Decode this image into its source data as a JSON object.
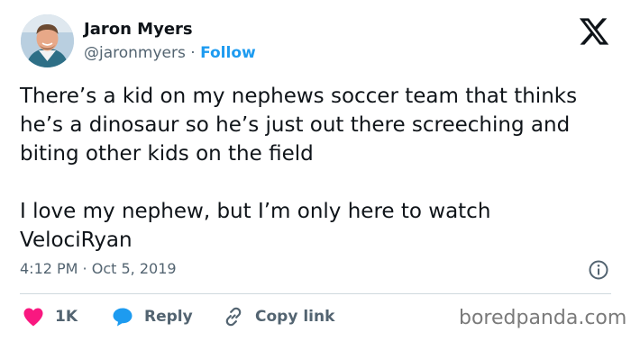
{
  "author": {
    "name": "Jaron Myers",
    "handle": "@jaronmyers",
    "separator": "·",
    "follow_label": "Follow"
  },
  "tweet": {
    "paragraphs": [
      "There’s a kid on my nephews soccer team that thinks he’s a dinosaur so he’s just out there screeching and biting other kids on the field",
      "I love my nephew, but I’m only here to watch VelociRyan"
    ],
    "timestamp": "4:12 PM · Oct 5, 2019"
  },
  "actions": {
    "like_count": "1K",
    "reply_label": "Reply",
    "copy_link_label": "Copy link"
  },
  "watermark": "boredpanda.com",
  "icons": {
    "platform": "x-logo-icon",
    "info": "info-icon",
    "like": "heart-icon",
    "reply": "speech-bubble-icon",
    "copy_link": "link-icon"
  },
  "colors": {
    "link": "#1d9bf0",
    "heart": "#f91880",
    "text": "#0f1419",
    "secondary": "#536471",
    "divider": "#cfd9de"
  }
}
